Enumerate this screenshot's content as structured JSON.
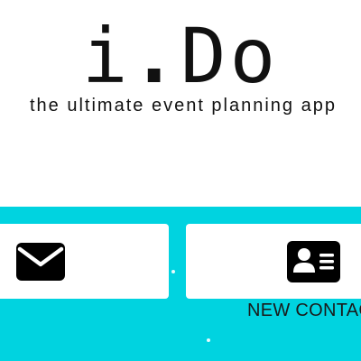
{
  "header": {
    "logo_letter_i": "i",
    "logo_dot": ".",
    "logo_letters_do": "Do",
    "tagline": "the ultimate event planning app"
  },
  "cards": [
    {
      "icon": "envelope-icon",
      "label": ""
    },
    {
      "icon": "contact-card-icon",
      "label": "NEW CONTACT"
    }
  ],
  "colors": {
    "accent": "#00d3e0",
    "card_background": "#ffffff",
    "text": "#111111"
  }
}
